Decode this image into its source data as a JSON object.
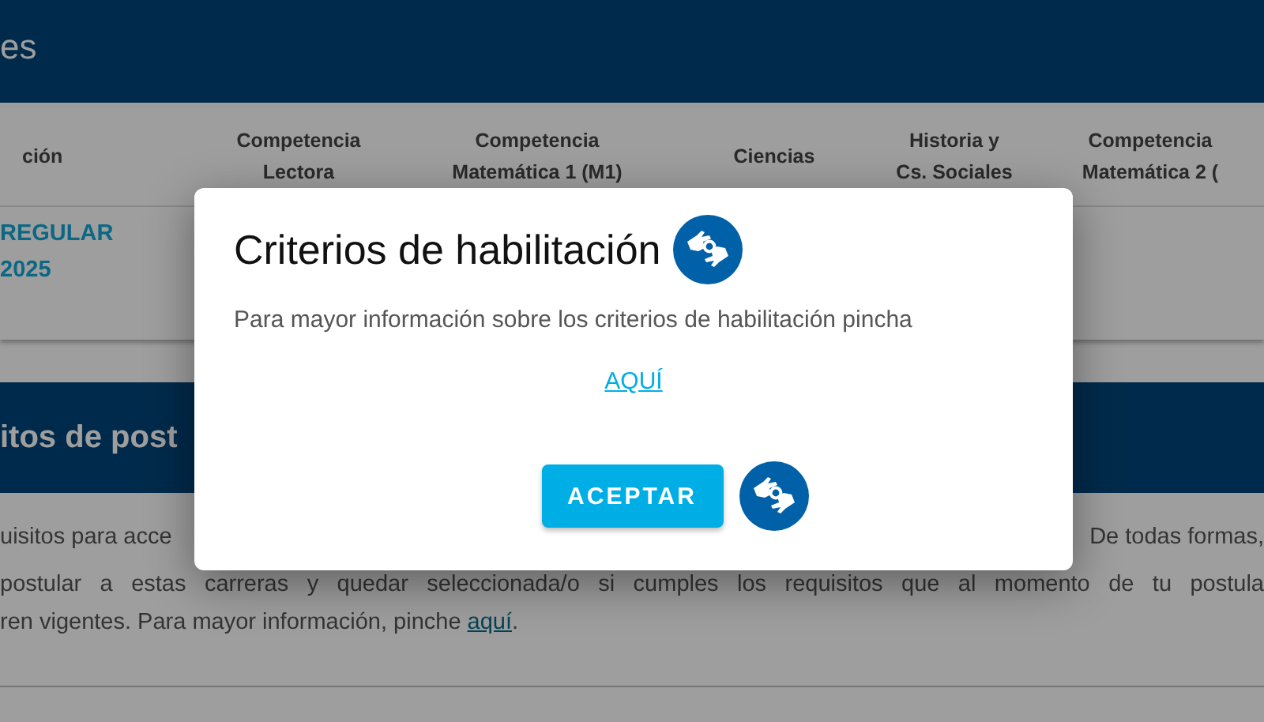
{
  "page": {
    "header_title": "es",
    "table": {
      "columns": [
        "ción",
        "Competencia Lectora",
        "Competencia Matemática 1 (M1)",
        "Ciencias",
        "Historia y Cs. Sociales",
        "Competencia Matemática 2 ("
      ],
      "rows": [
        {
          "cells": [
            "REGULAR 2025"
          ]
        }
      ]
    },
    "section_title": "itos de post",
    "paragraph": {
      "line_1_left": "uisitos para acce",
      "line_1_right": "De todas formas,",
      "line_2": "postular a estas carreras y quedar seleccionada/o si cumples los requisitos que al momento de tu postula",
      "line_3": "ren vigentes. Para mayor información, pinche",
      "link": "aquí",
      "line_3_end": "."
    }
  },
  "dialog": {
    "title": "Criterios de habilitación",
    "message": "Para mayor información sobre los criterios de habilitación pincha",
    "link": "AQUÍ",
    "button": "ACEPTAR"
  }
}
